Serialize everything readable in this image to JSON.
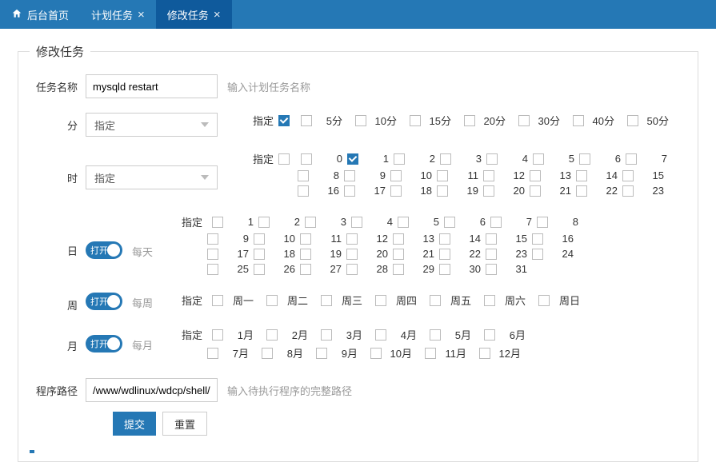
{
  "tabs": {
    "home": "后台首页",
    "plan": "计划任务",
    "edit": "修改任务"
  },
  "legend": "修改任务",
  "labels": {
    "taskName": "任务名称",
    "minute": "分",
    "hour": "时",
    "day": "日",
    "week": "周",
    "month": "月",
    "path": "程序路径",
    "spec": "指定"
  },
  "hints": {
    "taskName": "输入计划任务名称",
    "path": "输入待执行程序的完整路径",
    "everyDay": "每天",
    "everyWeek": "每周",
    "everyMonth": "每月"
  },
  "values": {
    "taskName": "mysqld restart",
    "selectSpec": "指定",
    "path": "/www/wdlinux/wdcp/shell/m",
    "toggleOn": "打开"
  },
  "minuteOpts": [
    "5分",
    "10分",
    "15分",
    "20分",
    "30分",
    "40分",
    "50分"
  ],
  "hourOpts": [
    "0",
    "1",
    "2",
    "3",
    "4",
    "5",
    "6",
    "7",
    "8",
    "9",
    "10",
    "11",
    "12",
    "13",
    "14",
    "15",
    "16",
    "17",
    "18",
    "19",
    "20",
    "21",
    "22",
    "23"
  ],
  "hourChecked": [
    "1"
  ],
  "dayOpts": [
    "1",
    "2",
    "3",
    "4",
    "5",
    "6",
    "7",
    "8",
    "9",
    "10",
    "11",
    "12",
    "13",
    "14",
    "15",
    "16",
    "17",
    "18",
    "19",
    "20",
    "21",
    "22",
    "23",
    "24",
    "25",
    "26",
    "27",
    "28",
    "29",
    "30",
    "31"
  ],
  "weekOpts": [
    "周一",
    "周二",
    "周三",
    "周四",
    "周五",
    "周六",
    "周日"
  ],
  "monthOpts": [
    "1月",
    "2月",
    "3月",
    "4月",
    "5月",
    "6月",
    "7月",
    "8月",
    "9月",
    "10月",
    "11月",
    "12月"
  ],
  "buttons": {
    "submit": "提交",
    "reset": "重置"
  }
}
